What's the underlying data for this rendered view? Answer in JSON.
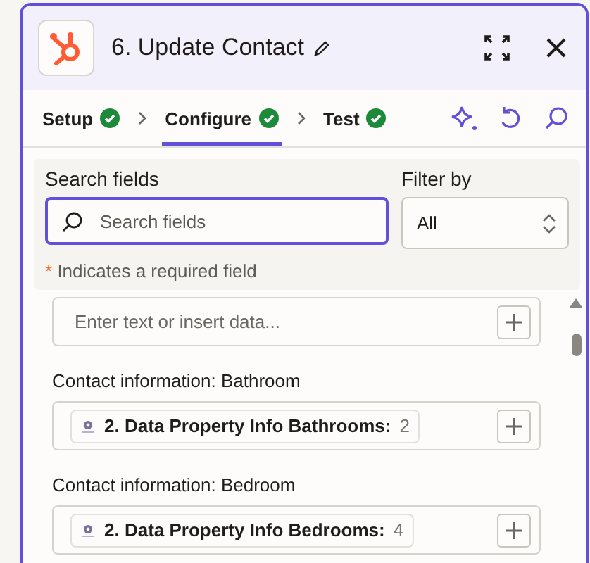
{
  "header": {
    "title": "6. Update Contact"
  },
  "steps": [
    {
      "label": "Setup",
      "complete": true,
      "selected": false
    },
    {
      "label": "Configure",
      "complete": true,
      "selected": true
    },
    {
      "label": "Test",
      "complete": true,
      "selected": false
    }
  ],
  "search": {
    "label": "Search fields",
    "placeholder": "Search fields"
  },
  "filter": {
    "label": "Filter by",
    "value": "All"
  },
  "required_note": {
    "marker": "*",
    "text": "Indicates a required field"
  },
  "fields": [
    {
      "kind": "input",
      "placeholder": "Enter text or insert data..."
    },
    {
      "kind": "pill",
      "label": "Contact information: Bathroom",
      "source": "2. Data Property Info Bathrooms:",
      "value": "2"
    },
    {
      "kind": "pill",
      "label": "Contact information: Bedroom",
      "source": "2. Data Property Info Bedrooms:",
      "value": "4"
    }
  ]
}
